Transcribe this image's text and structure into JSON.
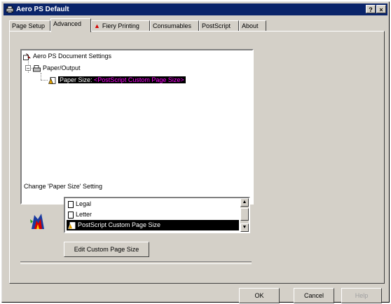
{
  "window": {
    "title": "Aero PS Default",
    "help_button": "?",
    "close_button": "×"
  },
  "tabs": [
    {
      "label": "Page Setup"
    },
    {
      "label": "Advanced"
    },
    {
      "label": "Fiery Printing"
    },
    {
      "label": "Consumables"
    },
    {
      "label": "PostScript"
    },
    {
      "label": "About"
    }
  ],
  "tree": {
    "root": "Aero PS Document Settings",
    "group": "Paper/Output",
    "item_label": "Paper Size:",
    "item_value": "<PostScript Custom Page Size>"
  },
  "setting": {
    "label": "Change 'Paper Size' Setting",
    "options": [
      "Legal",
      "Letter",
      "PostScript Custom Page Size"
    ],
    "selected": "PostScript Custom Page Size"
  },
  "buttons": {
    "edit_custom": "Edit Custom Page Size",
    "ok": "OK",
    "cancel": "Cancel",
    "help": "Help"
  }
}
